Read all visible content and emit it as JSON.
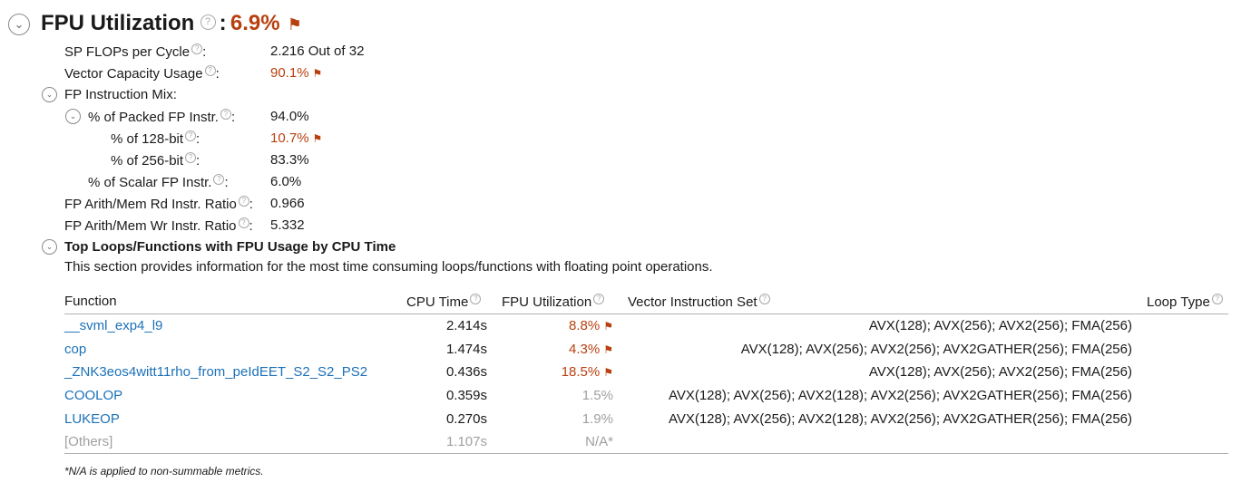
{
  "title": {
    "label": "FPU Utilization",
    "colon": ":",
    "value": "6.9%"
  },
  "metrics": {
    "sp_flops": {
      "label": "SP FLOPs per Cycle",
      "value": "2.216 Out of 32"
    },
    "vector_capacity": {
      "label": "Vector Capacity Usage",
      "value": "90.1%"
    },
    "fp_mix": {
      "label": "FP Instruction Mix:"
    },
    "packed": {
      "label": "% of Packed FP Instr.",
      "value": "94.0%"
    },
    "bit128": {
      "label": "% of 128-bit",
      "value": "10.7%"
    },
    "bit256": {
      "label": "% of 256-bit",
      "value": "83.3%"
    },
    "scalar": {
      "label": "% of Scalar FP Instr.",
      "value": "6.0%"
    },
    "rd_ratio": {
      "label": "FP Arith/Mem Rd Instr. Ratio",
      "value": "0.966"
    },
    "wr_ratio": {
      "label": "FP Arith/Mem Wr Instr. Ratio",
      "value": "5.332"
    }
  },
  "top_loops": {
    "title": "Top Loops/Functions with FPU Usage by CPU Time",
    "description": "This section provides information for the most time consuming loops/functions with floating point operations.",
    "columns": {
      "function": "Function",
      "cpu_time": "CPU Time",
      "fpu_util": "FPU Utilization",
      "vector_set": "Vector Instruction Set",
      "loop_type": "Loop Type"
    },
    "rows": [
      {
        "function": "__svml_exp4_l9",
        "cpu_time": "2.414s",
        "fpu": "8.8%",
        "vec": "AVX(128); AVX(256); AVX2(256); FMA(256)"
      },
      {
        "function": "cop",
        "cpu_time": "1.474s",
        "fpu": "4.3%",
        "vec": "AVX(128); AVX(256); AVX2(256); AVX2GATHER(256); FMA(256)"
      },
      {
        "function": "_ZNK3eos4witt11rho_from_peIdEET_S2_S2_PS2",
        "cpu_time": "0.436s",
        "fpu": "18.5%",
        "vec": "AVX(128); AVX(256); AVX2(256); FMA(256)"
      },
      {
        "function": "COOLOP",
        "cpu_time": "0.359s",
        "fpu": "1.5%",
        "vec": "AVX(128); AVX(256); AVX2(128); AVX2(256); AVX2GATHER(256); FMA(256)"
      },
      {
        "function": "LUKEOP",
        "cpu_time": "0.270s",
        "fpu": "1.9%",
        "vec": "AVX(128); AVX(256); AVX2(128); AVX2(256); AVX2GATHER(256); FMA(256)"
      },
      {
        "function": "[Others]",
        "cpu_time": "1.107s",
        "fpu": "N/A*",
        "vec": ""
      }
    ],
    "footnote": "*N/A is applied to non-summable metrics."
  },
  "colors": {
    "warning": "#b8400f",
    "link": "#1c71b8",
    "muted": "#a0a0a0"
  },
  "icons": {
    "collapse": "chevron-down-icon",
    "help": "help-icon",
    "flag": "flag-icon"
  }
}
